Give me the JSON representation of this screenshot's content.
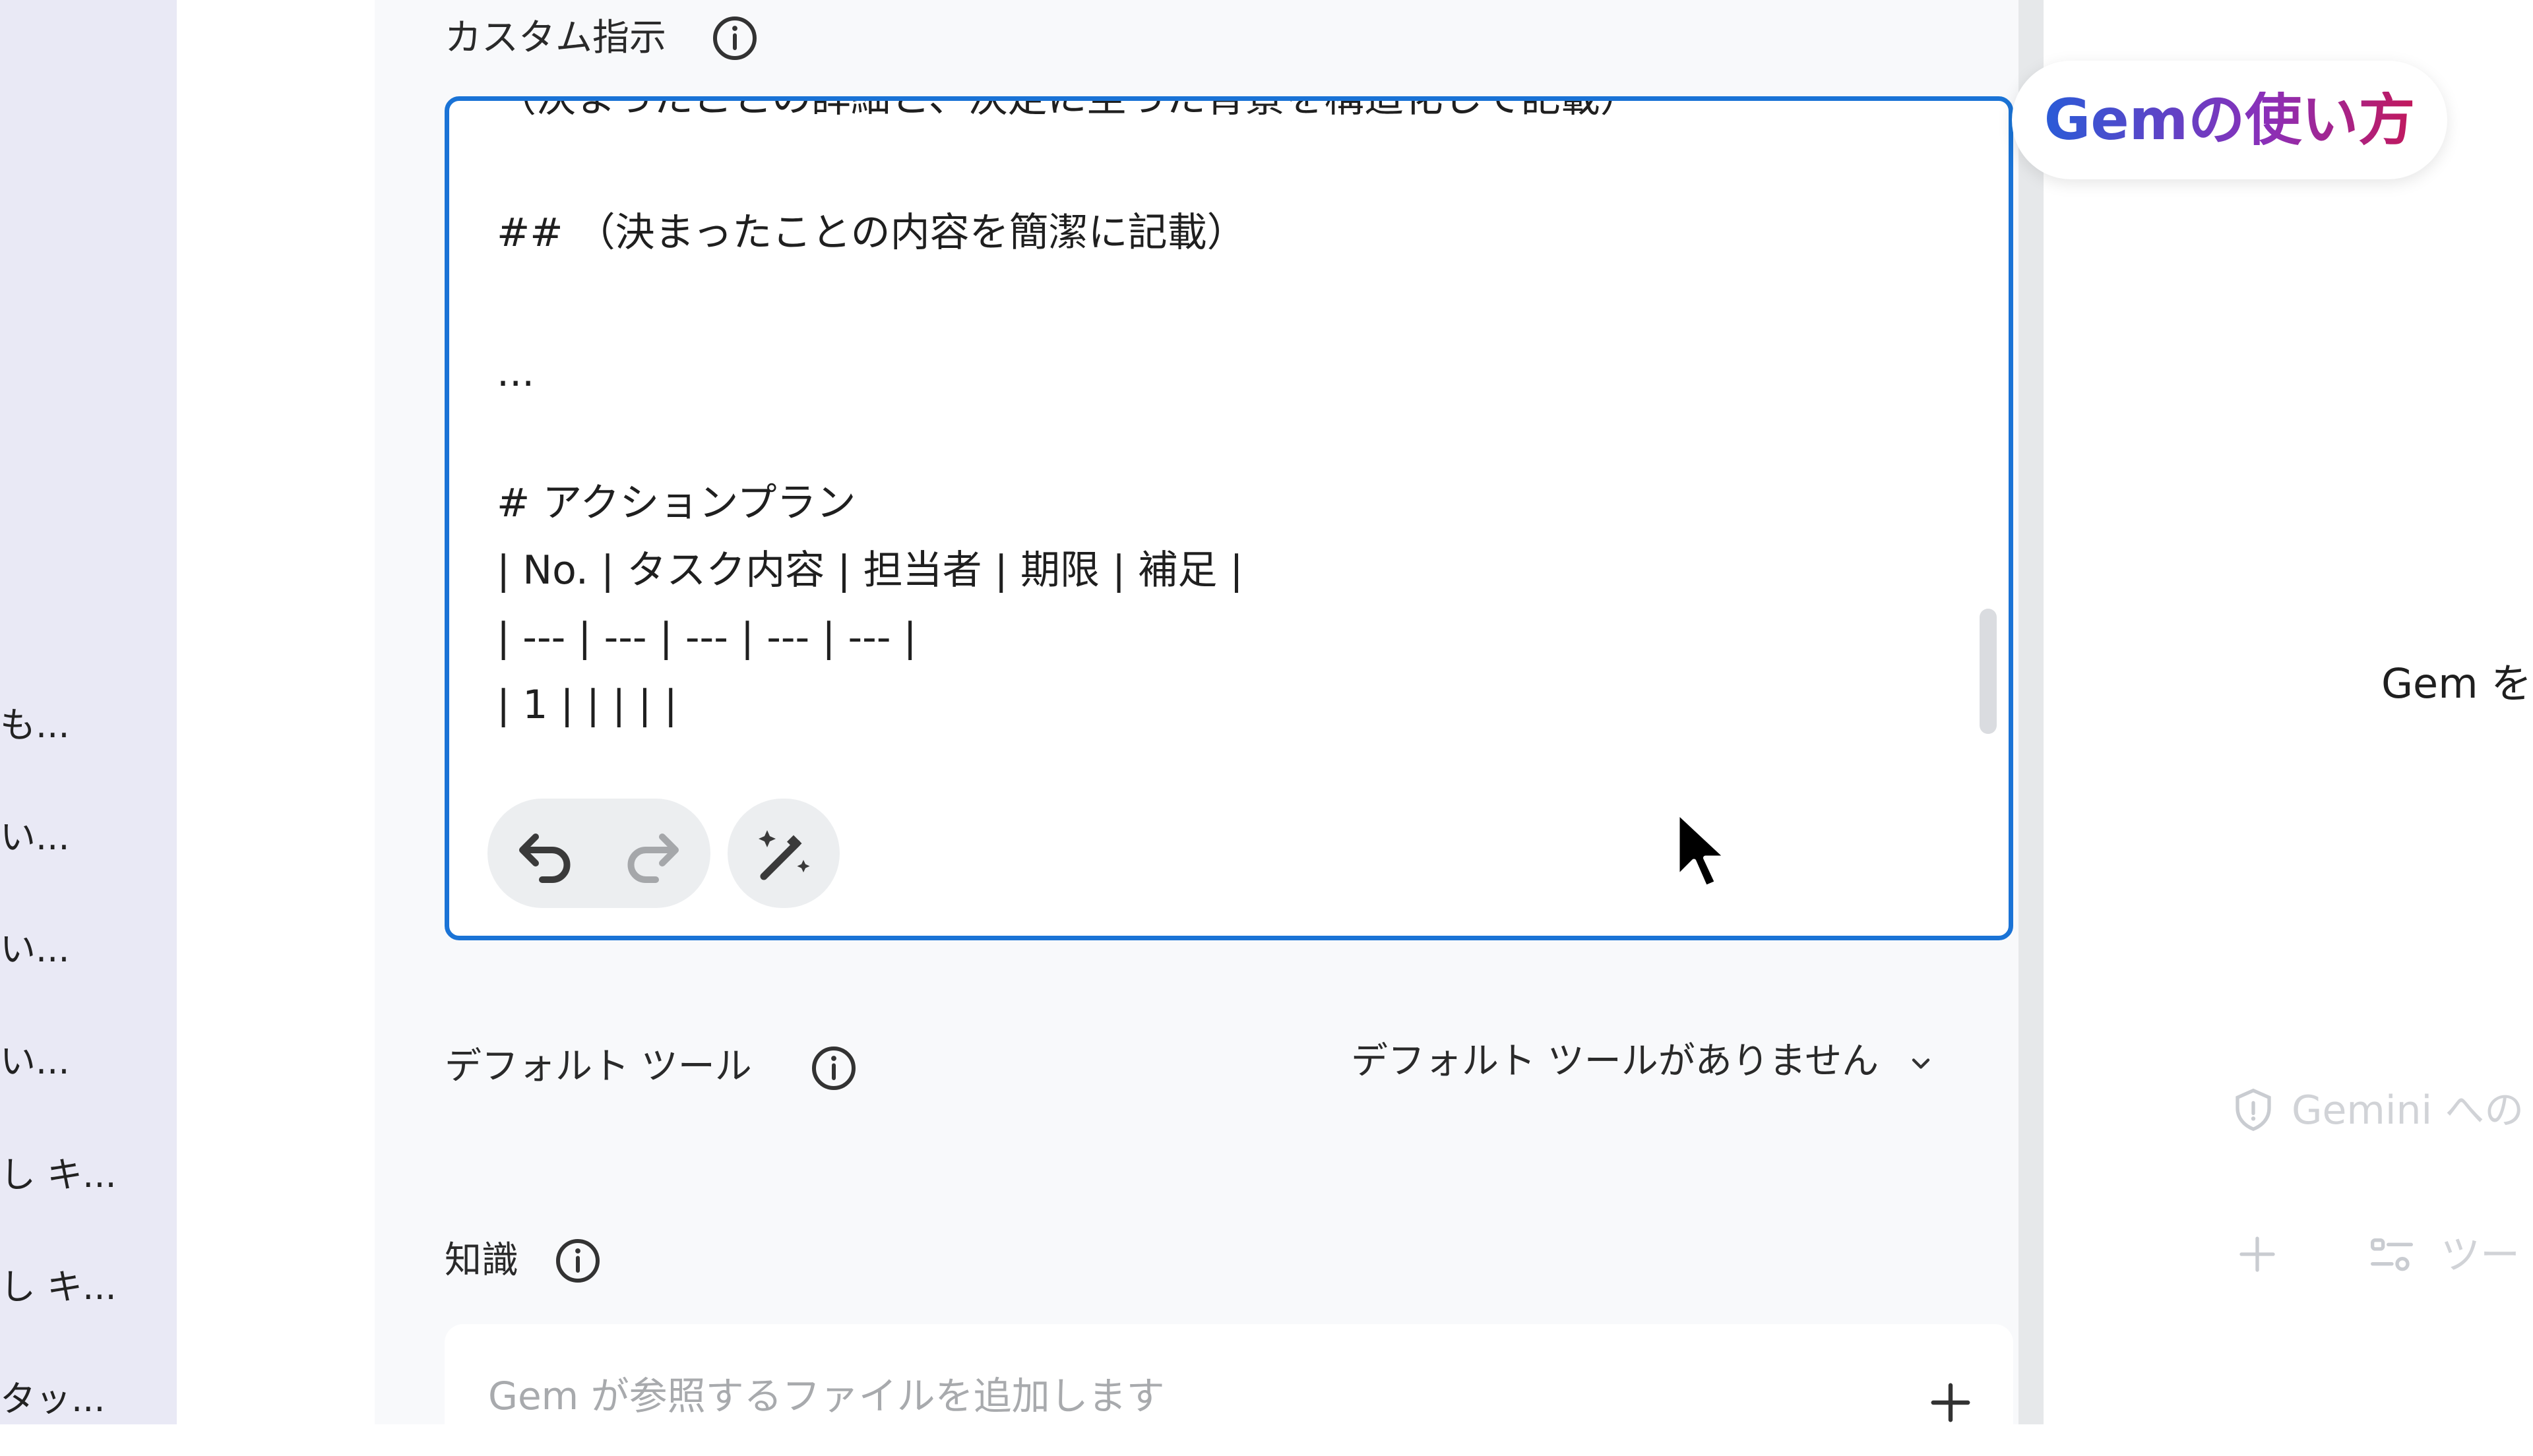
{
  "sidebar": {
    "items": [
      {
        "label": "も..."
      },
      {
        "label": "い..."
      },
      {
        "label": "い..."
      },
      {
        "label": "い..."
      },
      {
        "label": "し キ..."
      },
      {
        "label": "し キ..."
      },
      {
        "label": "タッ..."
      }
    ]
  },
  "custom_instructions": {
    "label": "カスタム指示",
    "info_icon": "info-icon",
    "lines": [
      "（決まったことの詳細と、決定に至った背景を構造化して記載）",
      "## （決まったことの内容を簡潔に記載）",
      "...",
      "# アクションプラン",
      "| No. | タスク内容 | 担当者 | 期限 | 補足 |",
      "| --- | --- | --- | --- | --- |",
      "| 1 | | | | |"
    ],
    "toolbar": {
      "undo_icon": "undo-icon",
      "redo_icon": "redo-icon",
      "magic_icon": "magic-wand-icon"
    }
  },
  "default_tools": {
    "label": "デフォルト ツール",
    "dropdown_value": "デフォルト ツールがありません"
  },
  "knowledge": {
    "label": "知識",
    "placeholder": "Gem が参照するファイルを追加します"
  },
  "right_panel": {
    "gem_guide": "Gemの使い方",
    "preview_text": "Gem を",
    "privacy_text": "Gemini への",
    "tools_text": "ツー"
  },
  "colors": {
    "accent": "#1a73d6",
    "sidebar_bg": "#e9e9f5",
    "main_bg": "#f8f9fb"
  }
}
